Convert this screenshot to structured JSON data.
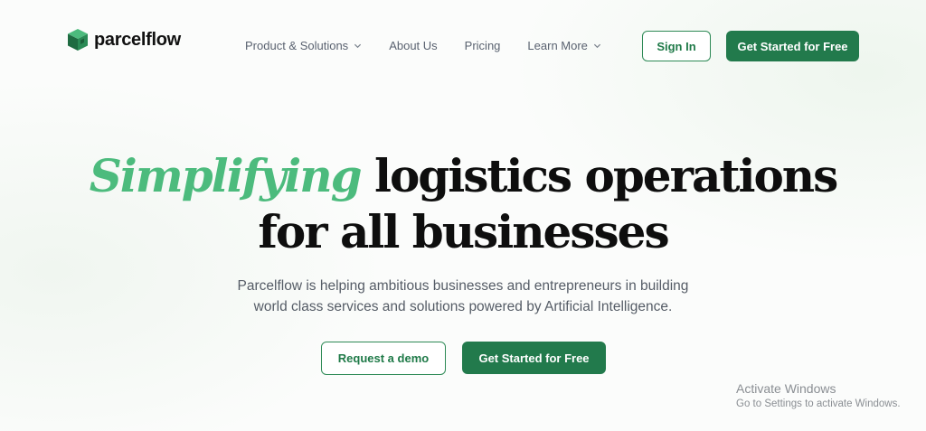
{
  "brand": {
    "name": "parcelflow",
    "logo_icon": "cube-logo-icon",
    "accent_color": "#4cbb7d",
    "primary_color": "#227a4c"
  },
  "nav": {
    "items": [
      {
        "label": "Product & Solutions",
        "has_dropdown": true
      },
      {
        "label": "About Us",
        "has_dropdown": false
      },
      {
        "label": "Pricing",
        "has_dropdown": false
      },
      {
        "label": "Learn More",
        "has_dropdown": true
      }
    ],
    "sign_in": "Sign In",
    "get_started": "Get Started for Free"
  },
  "hero": {
    "title_accent": "Simplifying",
    "title_line1_rest": "logistics operations",
    "title_line2": "for all businesses",
    "subtitle_line1": "Parcelflow is helping ambitious businesses and entrepreneurs in building",
    "subtitle_line2": "world class services and solutions powered by Artificial Intelligence.",
    "demo_button": "Request a demo",
    "cta_button": "Get Started for Free"
  },
  "watermark": {
    "title": "Activate Windows",
    "subtitle": "Go to Settings to activate Windows."
  }
}
